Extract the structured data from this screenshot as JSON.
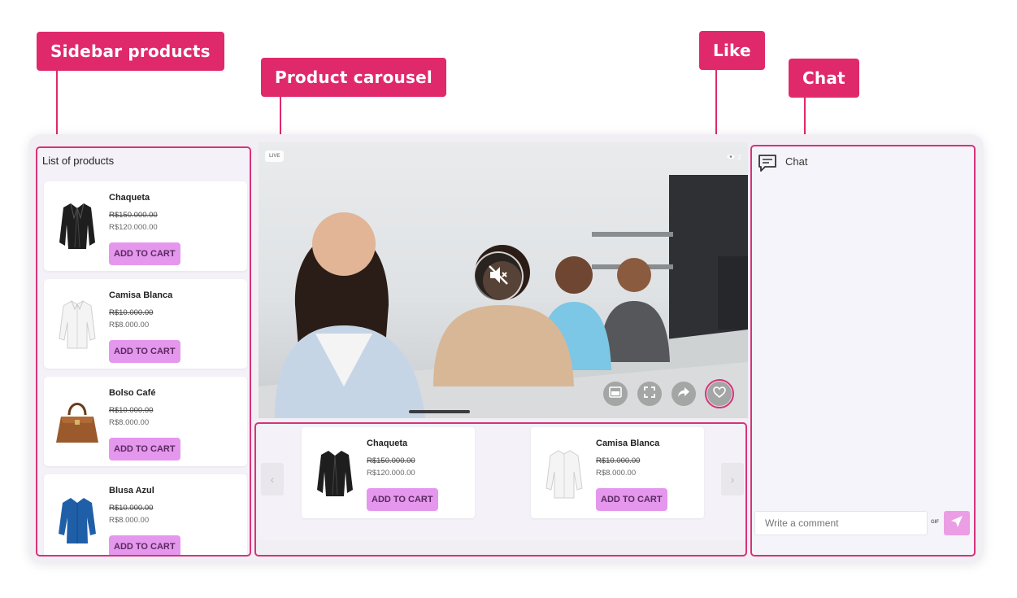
{
  "callouts": {
    "sidebar_products": "Sidebar products",
    "product_carousel": "Product carousel",
    "like": "Like",
    "chat": "Chat"
  },
  "sidebar": {
    "title": "List of products",
    "products": [
      {
        "name": "Chaqueta",
        "old_price": "R$150.000.00",
        "price": "R$120.000.00",
        "button": "ADD TO CART",
        "icon": "jacket-icon"
      },
      {
        "name": "Camisa Blanca",
        "old_price": "R$10.000.00",
        "price": "R$8.000.00",
        "button": "ADD TO CART",
        "icon": "shirt-icon"
      },
      {
        "name": "Bolso Café",
        "old_price": "R$10.000.00",
        "price": "R$8.000.00",
        "button": "ADD TO CART",
        "icon": "handbag-icon"
      },
      {
        "name": "Blusa Azul",
        "old_price": "R$10.000.00",
        "price": "R$8.000.00",
        "button": "ADD TO CART",
        "icon": "blouse-icon"
      }
    ]
  },
  "video": {
    "live_label": "LIVE",
    "viewer_count": "2",
    "controls": [
      "picture-in-picture-icon",
      "fullscreen-icon",
      "share-icon",
      "heart-icon"
    ]
  },
  "carousel": {
    "products": [
      {
        "name": "Chaqueta",
        "old_price": "R$150.000.00",
        "price": "R$120.000.00",
        "button": "ADD TO CART"
      },
      {
        "name": "Camisa Blanca",
        "old_price": "R$10.000.00",
        "price": "R$8.000.00",
        "button": "ADD TO CART"
      }
    ]
  },
  "chat": {
    "title": "Chat",
    "placeholder": "Write a comment",
    "gif_label": "GIF"
  },
  "colors": {
    "accent": "#e0296b",
    "button": "#e497ec",
    "send": "#ec9ee4"
  }
}
